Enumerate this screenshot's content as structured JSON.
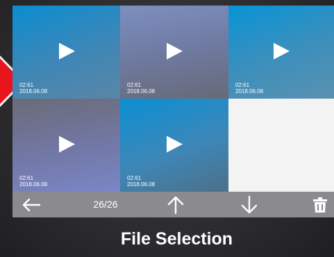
{
  "thumbnails": [
    {
      "duration": "02:61",
      "date": "2018.06.08",
      "gradient": "linear-gradient(160deg, #0a8dd0 0%, #3f86b6 55%, #5a86a6 100%)"
    },
    {
      "duration": "02:61",
      "date": "2018.06.08",
      "gradient": "linear-gradient(170deg, #7d8fc0 0%, #6f7aa0 50%, #666a78 100%)"
    },
    {
      "duration": "02:61",
      "date": "2018.06.08",
      "gradient": "linear-gradient(160deg, #0794d6 0%, #3a8fbd 50%, #5b90b0 100%)"
    },
    {
      "duration": "02:61",
      "date": "2018.06.08",
      "gradient": "linear-gradient(170deg, #6a6b78 0%, #7278a6 55%, #7a86c6 100%)"
    },
    {
      "duration": "02:61",
      "date": "2018.06.08",
      "gradient": "linear-gradient(160deg, #0a8fd4 0%, #3d87b8 55%, #4d6f88 100%)"
    }
  ],
  "toolbar": {
    "page_counter": "26/26",
    "background": "#8b8b8e"
  },
  "caption": "File Selection",
  "colors": {
    "accent_red": "#e8141e",
    "empty_slot": "#f3f3f3"
  },
  "icons": {
    "back": "back-arrow-icon",
    "up": "up-arrow-icon",
    "down": "down-arrow-icon",
    "delete": "trash-icon",
    "play": "play-icon",
    "pointer": "red-pointer-icon"
  }
}
